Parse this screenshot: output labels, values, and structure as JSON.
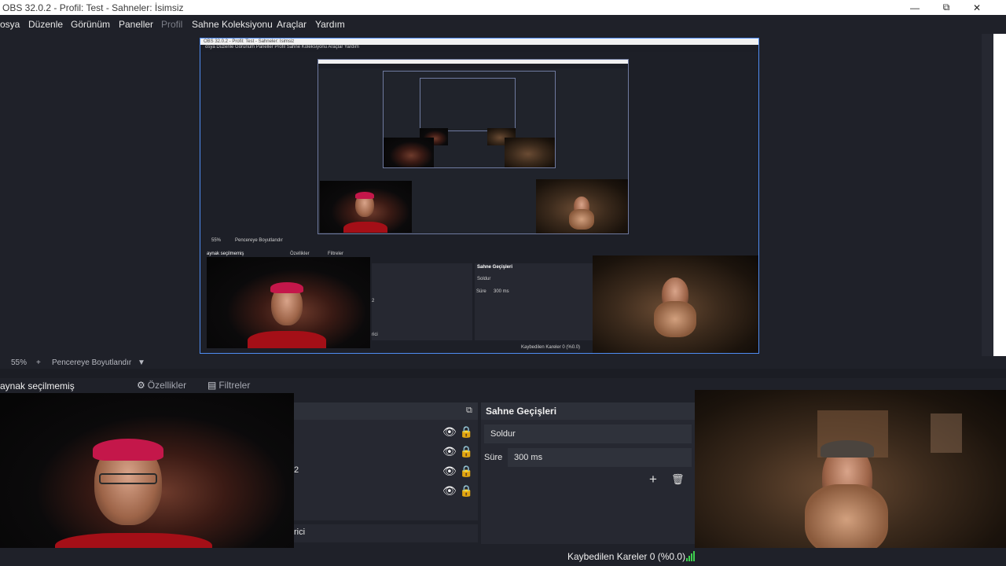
{
  "window": {
    "title": "OBS 32.0.2 - Profil: Test - Sahneler: İsimsiz",
    "controls": {
      "minimize": "—",
      "maximize": "⧉",
      "close": "✕"
    }
  },
  "menu": {
    "items": [
      {
        "label": "osya",
        "disabled": false
      },
      {
        "label": "Düzenle",
        "disabled": false
      },
      {
        "label": "Görünüm",
        "disabled": false
      },
      {
        "label": "Paneller",
        "disabled": false
      },
      {
        "label": "Profil",
        "disabled": true
      },
      {
        "label": "Sahne Koleksiyonu",
        "disabled": false
      },
      {
        "label": "Araçlar",
        "disabled": false
      },
      {
        "label": "Yardım",
        "disabled": false
      }
    ]
  },
  "preview": {
    "zoom": "55%",
    "zoom_plus": "+",
    "fit_label": "Pencereye Boyutlandır",
    "nested_title": "OBS 32.0.2 - Profil: Test - Sahneler: İsimsiz",
    "nested_menu": "osya  Düzenle  Görünüm  Paneller  Profil  Sahne Koleksiyonu  Araçlar  Yardım",
    "nested_source": "aynak seçilmemiş",
    "nested_props": "Özellikler",
    "nested_filters": "Filtreler",
    "nested_trans": "Sahne Geçişleri",
    "nested_fade": "Soldur",
    "nested_duration": "Süre",
    "nested_duration_val": "300 ms",
    "nested_dropped": "Kaybedilen Kareler 0 (%0.0)",
    "nested_row_suffix": "2",
    "nested_cut": "rici"
  },
  "sources": {
    "no_source_label": "aynak seçilmemiş",
    "properties_label": "Özellikler",
    "filters_label": "Filtreler",
    "row_suffix": "2",
    "bottom_cut": "rici"
  },
  "transitions": {
    "title": "Sahne Geçişleri",
    "type": "Soldur",
    "duration_label": "Süre",
    "duration_value": "300 ms",
    "add": "+"
  },
  "status": {
    "dropped_frames": "Kaybedilen Kareler 0 (%0.0)"
  },
  "colors": {
    "accent": "#4f8cf2",
    "signal": "#3ed04f"
  }
}
